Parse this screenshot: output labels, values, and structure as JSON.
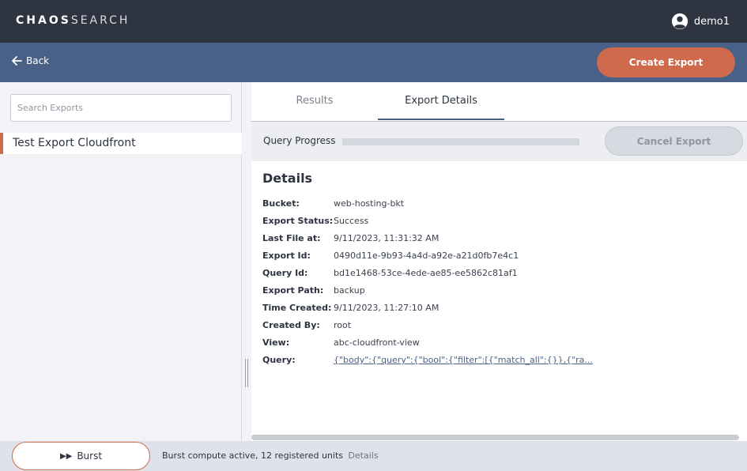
{
  "header": {
    "logo_bold": "CHAOS",
    "logo_thin": "SEARCH",
    "user_name": "demo1"
  },
  "toolbar": {
    "back_label": "Back",
    "create_label": "Create Export"
  },
  "sidebar": {
    "search_placeholder": "Search Exports",
    "items": [
      {
        "label": "Test Export Cloudfront",
        "selected": true
      }
    ]
  },
  "tabs": [
    {
      "label": "Results",
      "active": false
    },
    {
      "label": "Export Details",
      "active": true
    }
  ],
  "progress": {
    "label": "Query Progress",
    "value": 0,
    "cancel_label": "Cancel Export"
  },
  "details": {
    "title": "Details",
    "fields": [
      {
        "key": "Bucket:",
        "value": "web-hosting-bkt"
      },
      {
        "key": "Export Status:",
        "value": "Success"
      },
      {
        "key": "Last File at:",
        "value": "9/11/2023, 11:31:32 AM"
      },
      {
        "key": "Export Id:",
        "value": "0490d11e-9b93-4a4d-a92e-a21d0fb7e4c1"
      },
      {
        "key": "Query Id:",
        "value": "bd1e1468-53ce-4ede-ae85-ee5862c81af1"
      },
      {
        "key": "Export Path:",
        "value": "backup"
      },
      {
        "key": "Time Created:",
        "value": "9/11/2023, 11:27:10 AM"
      },
      {
        "key": "Created By:",
        "value": "root"
      },
      {
        "key": "View:",
        "value": "abc-cloudfront-view"
      },
      {
        "key": "Query:",
        "value": "{\"body\":{\"query\":{\"bool\":{\"filter\":[{\"match_all\":{}},{\"ra..."
      }
    ]
  },
  "footer": {
    "burst_label": "Burst",
    "status": "Burst compute active, 12 registered units",
    "details_link": "Details"
  },
  "colors": {
    "accent": "#d06a4d",
    "nav": "#4a6187",
    "topbar": "#2e3540"
  }
}
